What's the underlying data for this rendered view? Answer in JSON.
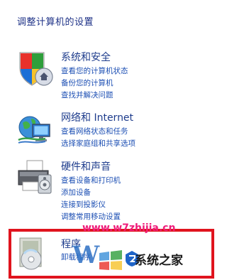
{
  "page": {
    "title": "调整计算机的设置"
  },
  "categories": {
    "security": {
      "title": "系统和安全",
      "links": [
        "查看您的计算机状态",
        "备份您的计算机",
        "查找并解决问题"
      ]
    },
    "network": {
      "title": "网络和 Internet",
      "links": [
        "查看网络状态和任务",
        "选择家庭组和共享选项"
      ]
    },
    "hardware": {
      "title": "硬件和声音",
      "links": [
        "查看设备和打印机",
        "添加设备",
        "连接到投影仪",
        "调整常用移动设置"
      ]
    },
    "programs": {
      "title": "程序",
      "links": [
        "卸载程序"
      ]
    }
  },
  "watermark": {
    "url": "www.w7zhijia.cn",
    "brand": "系统之家"
  },
  "colors": {
    "title": "#1e3287",
    "link": "#1e50b4",
    "highlight_frame": "#e0141e",
    "watermark_url": "#ef1d7a"
  },
  "icons": {
    "security": "shield-icon",
    "network": "network-globe-icon",
    "hardware": "printer-icon",
    "programs": "programs-cd-icon"
  }
}
